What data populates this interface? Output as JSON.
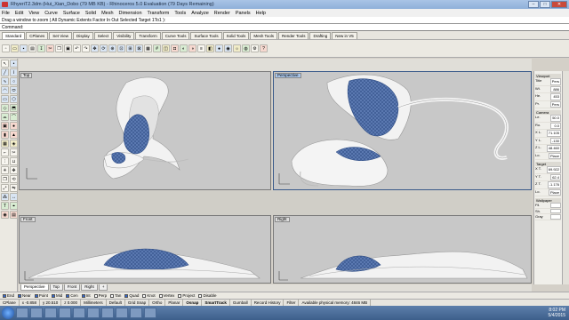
{
  "window": {
    "title": "RhyeriT2.3dm (Hui_Xian_Dobo (79 MB KB) - Rhinoceros 5.0 Evaluation (79 Days Remaining)",
    "buttons": [
      "–",
      "□",
      "✕"
    ]
  },
  "menu": [
    "File",
    "Edit",
    "View",
    "Curve",
    "Surface",
    "Solid",
    "Mesh",
    "Dimension",
    "Transform",
    "Tools",
    "Analyze",
    "Render",
    "Panels",
    "Help"
  ],
  "command_history": "Drag a window to zoom ( All  Dynamic  Extents  Factor  In  Out  Selected  Target  1To1 ):",
  "command_prompt": "Command:",
  "toolbar_tabs": [
    "Standard",
    "CPlanes",
    "Set View",
    "Display",
    "Select",
    "Visibility",
    "Transform",
    "Curve Tools",
    "Surface Tools",
    "Solid Tools",
    "Mesh Tools",
    "Render Tools",
    "Drafting",
    "New in V5"
  ],
  "viewports": {
    "top": "Top",
    "perspective": "Perspective",
    "front": "Front",
    "right": "Right"
  },
  "viewport_tabs": [
    "Perspective",
    "Top",
    "Front",
    "Right",
    "+"
  ],
  "properties": {
    "viewport_header": "Viewport",
    "rows": [
      {
        "k": "Title",
        "v": "Pers"
      },
      {
        "k": "Wi.",
        "v": "886"
      },
      {
        "k": "He.",
        "v": "453"
      },
      {
        "k": "Pr.",
        "v": "Pers"
      }
    ],
    "camera_header": "Camera",
    "camera_rows": [
      {
        "k": "Le.",
        "v": "50.0"
      },
      {
        "k": "Ro.",
        "v": "0.0"
      },
      {
        "k": "X L.",
        "v": "71.105"
      },
      {
        "k": "Y L.",
        "v": "-130"
      },
      {
        "k": "Z L.",
        "v": "48.460"
      },
      {
        "k": "Lo.",
        "v": "Place"
      }
    ],
    "target_header": "Target",
    "target_rows": [
      {
        "k": "X T.",
        "v": "69.922"
      },
      {
        "k": "Y T.",
        "v": "62.4"
      },
      {
        "k": "Z T.",
        "v": "-1.176"
      },
      {
        "k": "Lo.",
        "v": "Place"
      }
    ],
    "wallpaper_header": "Wallpaper",
    "wallpaper_rows": [
      {
        "k": "Fil.",
        "v": ""
      },
      {
        "k": "Sh.",
        "v": ""
      },
      {
        "k": "Gray",
        "v": ""
      }
    ]
  },
  "osnap": [
    {
      "label": "End",
      "on": true
    },
    {
      "label": "Near",
      "on": true
    },
    {
      "label": "Point",
      "on": true
    },
    {
      "label": "Mid",
      "on": true
    },
    {
      "label": "Cen",
      "on": true
    },
    {
      "label": "Int",
      "on": true
    },
    {
      "label": "Perp",
      "on": false
    },
    {
      "label": "Tan",
      "on": false
    },
    {
      "label": "Quad",
      "on": true
    },
    {
      "label": "Knot",
      "on": false
    },
    {
      "label": "Vertex",
      "on": false
    },
    {
      "label": "Project",
      "on": false
    },
    {
      "label": "Disable",
      "on": false
    }
  ],
  "status": {
    "cplane": "CPlane",
    "x": "x -0.858",
    "y": "y 20.510",
    "z": "z 0.000",
    "units": "Millimeters",
    "layer": "Default",
    "items": [
      "Grid Snap",
      "Ortho",
      "Planar",
      "Osnap",
      "SmartTrack",
      "Gumball",
      "Record History",
      "Filter",
      "Available physical memory: 4846 MB"
    ]
  },
  "taskbar": {
    "time": "8:02 PM",
    "date": "5/4/2015"
  },
  "colors": {
    "mesh_blue": "#5a78b0",
    "viewport_bg": "#c8c8c8",
    "surface": "#f4f4f4"
  }
}
